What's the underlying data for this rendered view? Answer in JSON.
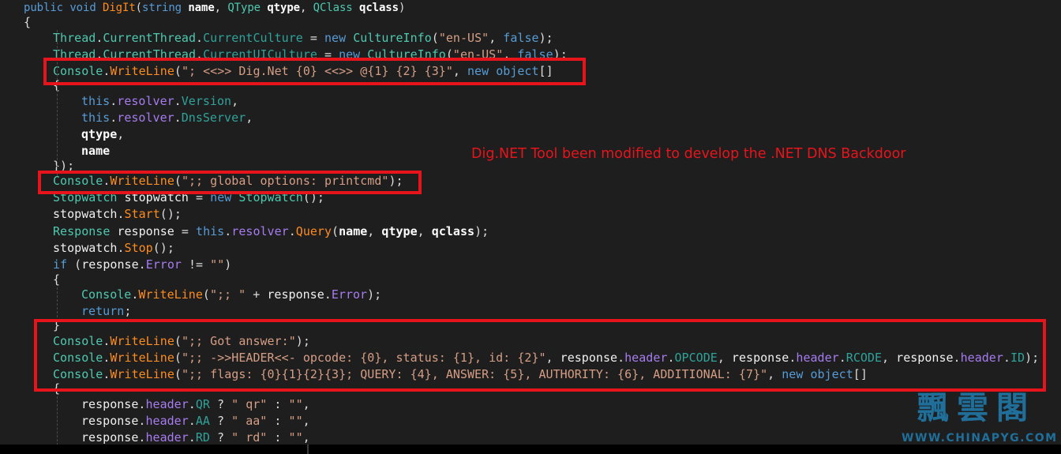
{
  "annotation": "Dig.NET Tool been modified to develop the .NET DNS Backdoor",
  "logo": {
    "cn": "飄雲閣",
    "url": "WWW.CHINAPYG.COM"
  },
  "colors": {
    "background": "#1e1e1e",
    "highlight_box": "#e8141c",
    "keyword": "#569cd6",
    "type": "#4ec9b0",
    "method": "#ff8c1a",
    "string": "#d69d85",
    "field": "#a77cf0"
  },
  "code": {
    "lines": [
      [
        [
          "kw",
          "public"
        ],
        [
          "p",
          " "
        ],
        [
          "kw",
          "void"
        ],
        [
          "p",
          " "
        ],
        [
          "m",
          "DigIt"
        ],
        [
          "p",
          "("
        ],
        [
          "kw",
          "string"
        ],
        [
          "p",
          " "
        ],
        [
          "b",
          "name"
        ],
        [
          "p",
          ", "
        ],
        [
          "t",
          "QType"
        ],
        [
          "p",
          " "
        ],
        [
          "b",
          "qtype"
        ],
        [
          "p",
          ", "
        ],
        [
          "t",
          "QClass"
        ],
        [
          "p",
          " "
        ],
        [
          "b",
          "qclass"
        ],
        [
          "p",
          ")"
        ]
      ],
      [
        [
          "p",
          "{"
        ]
      ],
      [
        [
          "t",
          "Thread"
        ],
        [
          "p",
          "."
        ],
        [
          "t",
          "CurrentThread"
        ],
        [
          "p",
          "."
        ],
        [
          "pr",
          "CurrentCulture"
        ],
        [
          "p",
          " = "
        ],
        [
          "kw",
          "new"
        ],
        [
          "p",
          " "
        ],
        [
          "t",
          "CultureInfo"
        ],
        [
          "p",
          "("
        ],
        [
          "s",
          "\"en-US\""
        ],
        [
          "p",
          ", "
        ],
        [
          "kw",
          "false"
        ],
        [
          "p",
          ");"
        ]
      ],
      [
        [
          "t",
          "Thread"
        ],
        [
          "p",
          "."
        ],
        [
          "t",
          "CurrentThread"
        ],
        [
          "p",
          "."
        ],
        [
          "pr",
          "CurrentUICulture"
        ],
        [
          "p",
          " = "
        ],
        [
          "kw",
          "new"
        ],
        [
          "p",
          " "
        ],
        [
          "t",
          "CultureInfo"
        ],
        [
          "p",
          "("
        ],
        [
          "s",
          "\"en-US\""
        ],
        [
          "p",
          ", "
        ],
        [
          "kw",
          "false"
        ],
        [
          "p",
          ");"
        ]
      ],
      [
        [
          "t",
          "Console"
        ],
        [
          "p",
          "."
        ],
        [
          "m",
          "WriteLine"
        ],
        [
          "p",
          "("
        ],
        [
          "s",
          "\"; <<>> Dig.Net {0} <<>> @{1} {2} {3}\""
        ],
        [
          "p",
          ", "
        ],
        [
          "kw",
          "new"
        ],
        [
          "p",
          " "
        ],
        [
          "kw",
          "object"
        ],
        [
          "p",
          "[]"
        ]
      ],
      [
        [
          "p",
          "{"
        ]
      ],
      [
        [
          "kw",
          "this"
        ],
        [
          "p",
          "."
        ],
        [
          "f",
          "resolver"
        ],
        [
          "p",
          "."
        ],
        [
          "pr",
          "Version"
        ],
        [
          "p",
          ","
        ]
      ],
      [
        [
          "kw",
          "this"
        ],
        [
          "p",
          "."
        ],
        [
          "f",
          "resolver"
        ],
        [
          "p",
          "."
        ],
        [
          "pr",
          "DnsServer"
        ],
        [
          "p",
          ","
        ]
      ],
      [
        [
          "b",
          "qtype"
        ],
        [
          "p",
          ","
        ]
      ],
      [
        [
          "b",
          "name"
        ]
      ],
      [
        [
          "p",
          "});"
        ]
      ],
      [
        [
          "t",
          "Console"
        ],
        [
          "p",
          "."
        ],
        [
          "m",
          "WriteLine"
        ],
        [
          "p",
          "("
        ],
        [
          "s",
          "\";; global options: printcmd\""
        ],
        [
          "p",
          ");"
        ]
      ],
      [
        [
          "t",
          "Stopwatch"
        ],
        [
          "id",
          " stopwatch "
        ],
        [
          "p",
          "= "
        ],
        [
          "kw",
          "new"
        ],
        [
          "p",
          " "
        ],
        [
          "t",
          "Stopwatch"
        ],
        [
          "p",
          "();"
        ]
      ],
      [
        [
          "id",
          "stopwatch"
        ],
        [
          "p",
          "."
        ],
        [
          "m",
          "Start"
        ],
        [
          "p",
          "();"
        ]
      ],
      [
        [
          "t",
          "Response"
        ],
        [
          "id",
          " response "
        ],
        [
          "p",
          "= "
        ],
        [
          "kw",
          "this"
        ],
        [
          "p",
          "."
        ],
        [
          "f",
          "resolver"
        ],
        [
          "p",
          "."
        ],
        [
          "m",
          "Query"
        ],
        [
          "p",
          "("
        ],
        [
          "b",
          "name"
        ],
        [
          "p",
          ", "
        ],
        [
          "b",
          "qtype"
        ],
        [
          "p",
          ", "
        ],
        [
          "b",
          "qclass"
        ],
        [
          "p",
          ");"
        ]
      ],
      [
        [
          "id",
          "stopwatch"
        ],
        [
          "p",
          "."
        ],
        [
          "m",
          "Stop"
        ],
        [
          "p",
          "();"
        ]
      ],
      [
        [
          "kw",
          "if"
        ],
        [
          "p",
          " ("
        ],
        [
          "id",
          "response"
        ],
        [
          "p",
          "."
        ],
        [
          "f",
          "Error"
        ],
        [
          "p",
          " != "
        ],
        [
          "s",
          "\"\""
        ],
        [
          "p",
          ")"
        ]
      ],
      [
        [
          "p",
          "{"
        ]
      ],
      [
        [
          "t",
          "Console"
        ],
        [
          "p",
          "."
        ],
        [
          "m",
          "WriteLine"
        ],
        [
          "p",
          "("
        ],
        [
          "s",
          "\";; \""
        ],
        [
          "p",
          " + "
        ],
        [
          "id",
          "response"
        ],
        [
          "p",
          "."
        ],
        [
          "f",
          "Error"
        ],
        [
          "p",
          ");"
        ]
      ],
      [
        [
          "kw",
          "return"
        ],
        [
          "p",
          ";"
        ]
      ],
      [
        [
          "p",
          "}"
        ]
      ],
      [
        [
          "t",
          "Console"
        ],
        [
          "p",
          "."
        ],
        [
          "m",
          "WriteLine"
        ],
        [
          "p",
          "("
        ],
        [
          "s",
          "\";; Got answer:\""
        ],
        [
          "p",
          ");"
        ]
      ],
      [
        [
          "t",
          "Console"
        ],
        [
          "p",
          "."
        ],
        [
          "m",
          "WriteLine"
        ],
        [
          "p",
          "("
        ],
        [
          "s",
          "\";; ->>HEADER<<- opcode: {0}, status: {1}, id: {2}\""
        ],
        [
          "p",
          ", "
        ],
        [
          "id",
          "response"
        ],
        [
          "p",
          "."
        ],
        [
          "f",
          "header"
        ],
        [
          "p",
          "."
        ],
        [
          "pr",
          "OPCODE"
        ],
        [
          "p",
          ", "
        ],
        [
          "id",
          "response"
        ],
        [
          "p",
          "."
        ],
        [
          "f",
          "header"
        ],
        [
          "p",
          "."
        ],
        [
          "pr",
          "RCODE"
        ],
        [
          "p",
          ", "
        ],
        [
          "id",
          "response"
        ],
        [
          "p",
          "."
        ],
        [
          "f",
          "header"
        ],
        [
          "p",
          "."
        ],
        [
          "pr",
          "ID"
        ],
        [
          "p",
          ");"
        ]
      ],
      [
        [
          "t",
          "Console"
        ],
        [
          "p",
          "."
        ],
        [
          "m",
          "WriteLine"
        ],
        [
          "p",
          "("
        ],
        [
          "s",
          "\";; flags: {0}{1}{2}{3}; QUERY: {4}, ANSWER: {5}, AUTHORITY: {6}, ADDITIONAL: {7}\""
        ],
        [
          "p",
          ", "
        ],
        [
          "kw",
          "new"
        ],
        [
          "p",
          " "
        ],
        [
          "kw",
          "object"
        ],
        [
          "p",
          "[]"
        ]
      ],
      [
        [
          "p",
          "{"
        ]
      ],
      [
        [
          "id",
          "response"
        ],
        [
          "p",
          "."
        ],
        [
          "f",
          "header"
        ],
        [
          "p",
          "."
        ],
        [
          "pr",
          "QR"
        ],
        [
          "p",
          " ? "
        ],
        [
          "s",
          "\" qr\""
        ],
        [
          "p",
          " : "
        ],
        [
          "s",
          "\"\""
        ],
        [
          "p",
          ","
        ]
      ],
      [
        [
          "id",
          "response"
        ],
        [
          "p",
          "."
        ],
        [
          "f",
          "header"
        ],
        [
          "p",
          "."
        ],
        [
          "pr",
          "AA"
        ],
        [
          "p",
          " ? "
        ],
        [
          "s",
          "\" aa\""
        ],
        [
          "p",
          " : "
        ],
        [
          "s",
          "\"\""
        ],
        [
          "p",
          ","
        ]
      ],
      [
        [
          "id",
          "response"
        ],
        [
          "p",
          "."
        ],
        [
          "f",
          "header"
        ],
        [
          "p",
          "."
        ],
        [
          "pr",
          "RD"
        ],
        [
          "p",
          " ? "
        ],
        [
          "s",
          "\" rd\""
        ],
        [
          "p",
          " : "
        ],
        [
          "s",
          "\"\""
        ],
        [
          "p",
          ","
        ]
      ]
    ]
  }
}
